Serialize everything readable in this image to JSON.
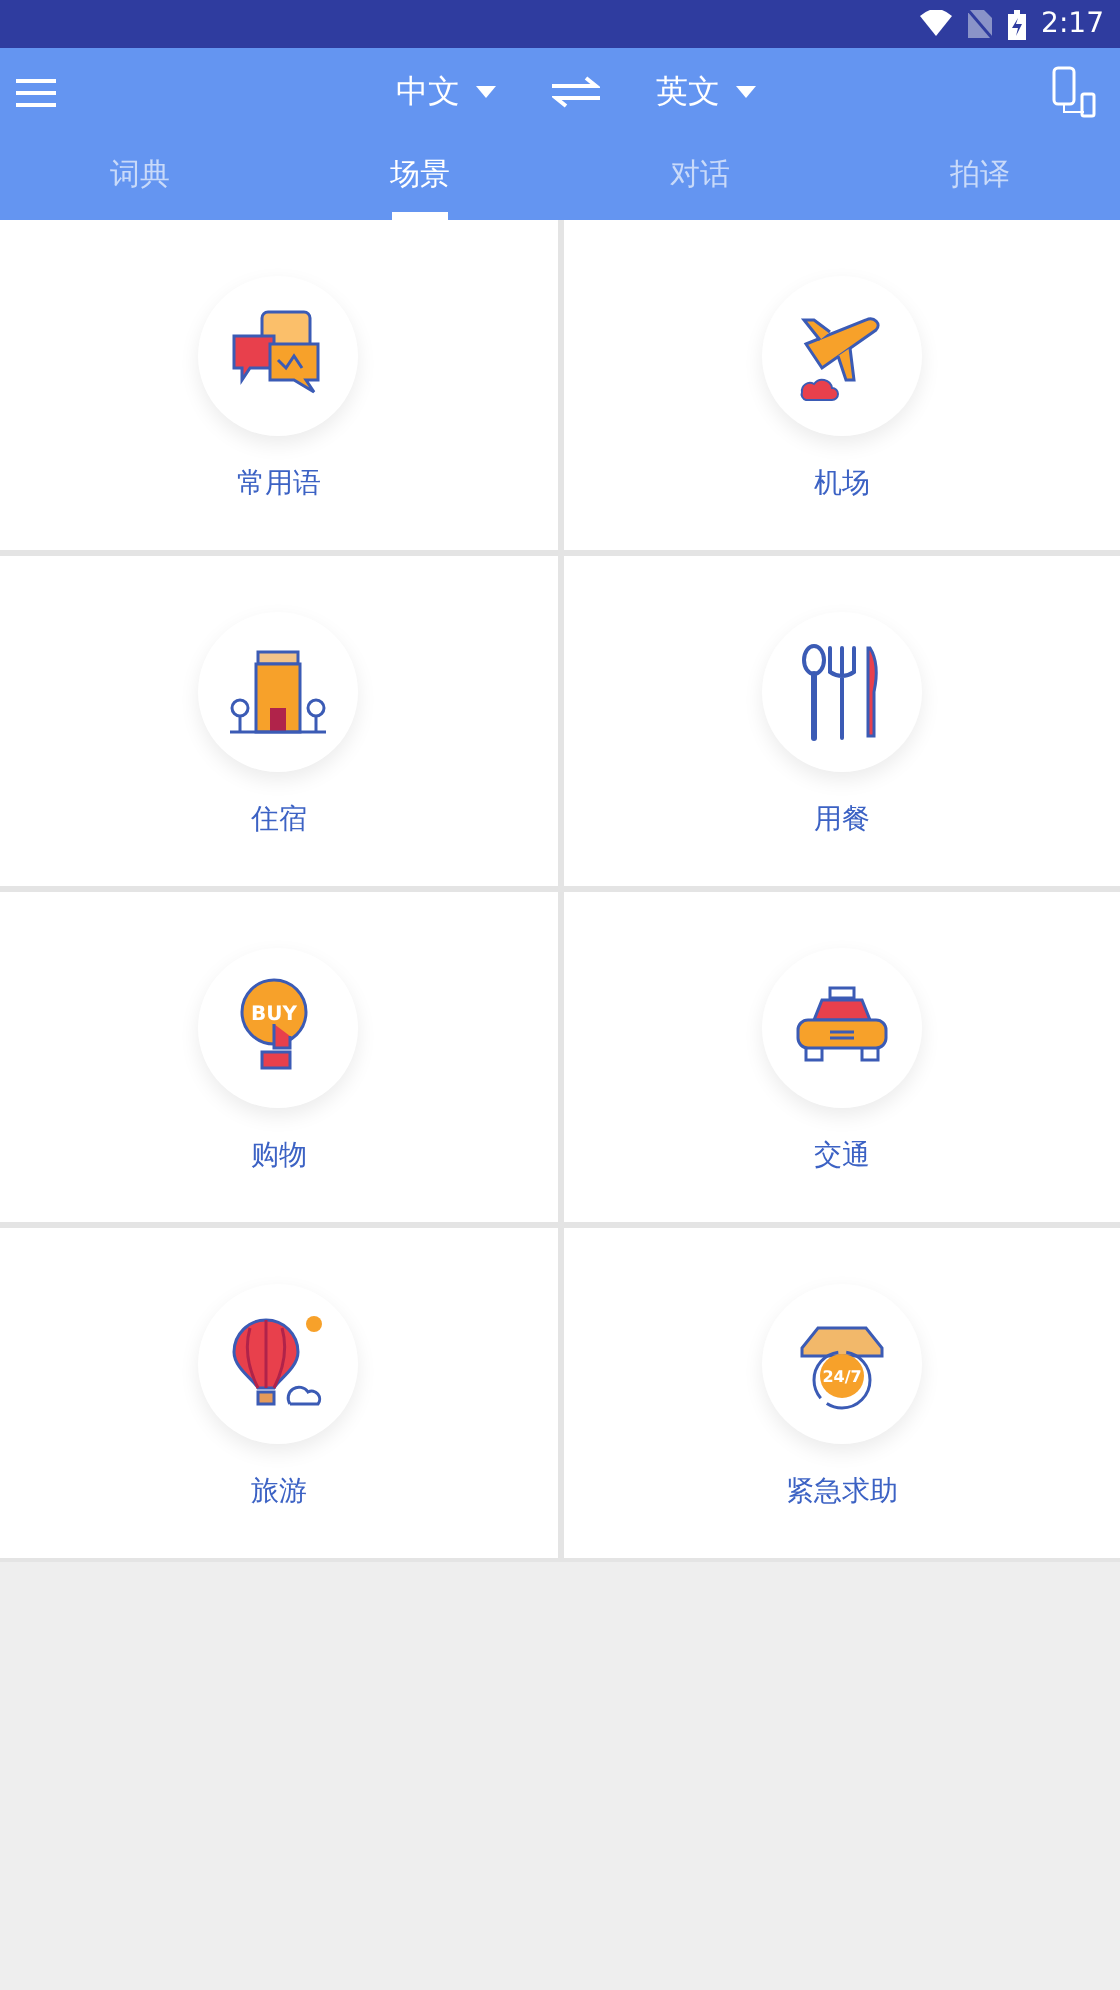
{
  "status_bar": {
    "time": "2:17"
  },
  "toolbar": {
    "source_language": "中文",
    "target_language": "英文"
  },
  "tabs": [
    {
      "label": "词典",
      "selected": false
    },
    {
      "label": "场景",
      "selected": true
    },
    {
      "label": "对话",
      "selected": false
    },
    {
      "label": "拍译",
      "selected": false
    }
  ],
  "scene_rows": [
    {
      "scenes": [
        {
          "label": "常用语",
          "kind": "chat"
        },
        {
          "label": "机场",
          "kind": "plane"
        }
      ]
    },
    {
      "scenes": [
        {
          "label": "住宿",
          "kind": "hotel"
        },
        {
          "label": "用餐",
          "kind": "cutlery"
        }
      ]
    },
    {
      "scenes": [
        {
          "kind": "buy",
          "icon_text": "BUY",
          "label": "购物"
        },
        {
          "label": "交通",
          "kind": "taxi"
        }
      ]
    },
    {
      "scenes": [
        {
          "label": "旅游",
          "kind": "balloon"
        },
        {
          "kind": "phone",
          "icon_text": "24/7",
          "label": "紧急求助"
        }
      ]
    }
  ]
}
